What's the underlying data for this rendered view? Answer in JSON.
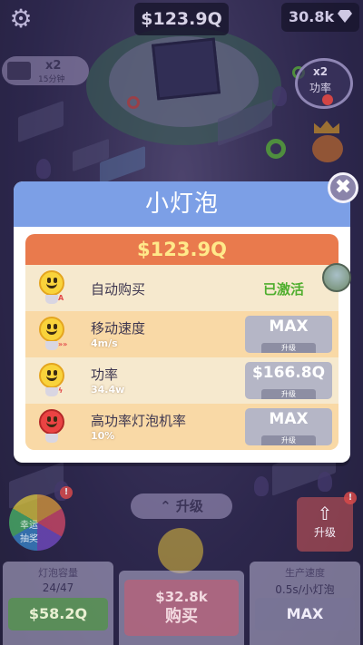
{
  "hud": {
    "money": "$123.9Q",
    "gems": "30.8k",
    "video_boost": {
      "multiplier": "x2",
      "duration": "15分钟"
    },
    "power_boost": {
      "multiplier": "x2",
      "label": "功率"
    }
  },
  "modal": {
    "title": "小灯泡",
    "price": "$123.9Q",
    "rows": [
      {
        "name": "自动购买",
        "sub": "",
        "status": "已激活",
        "button_value": "",
        "button_label": "",
        "icon": "bulb-auto-icon"
      },
      {
        "name": "移动速度",
        "sub": "4m/s",
        "status": "",
        "button_value": "MAX",
        "button_label": "升级",
        "icon": "bulb-speed-icon"
      },
      {
        "name": "功率",
        "sub": "34.4w",
        "status": "",
        "button_value": "$166.8Q",
        "button_label": "升级",
        "icon": "bulb-power-icon"
      },
      {
        "name": "高功率灯泡机率",
        "sub": "10%",
        "status": "",
        "button_value": "MAX",
        "button_label": "升级",
        "icon": "bulb-red-icon"
      }
    ]
  },
  "bottom": {
    "wheel_label": "幸运\n抽奖",
    "upgrade_tab": "升级",
    "upgrade_side": "升级",
    "left_panel": {
      "title": "灯泡容量",
      "info": "24/47",
      "button": "$58.2Q"
    },
    "mid_panel": {
      "price": "$32.8k",
      "label": "购买"
    },
    "right_panel": {
      "title": "生产速度",
      "info": "0.5s/小灯泡",
      "button": "MAX"
    }
  },
  "colors": {
    "header_blue": "#7c9fe6",
    "price_orange": "#e97a4d",
    "price_text": "#ffe98a",
    "active_green": "#4fae2e",
    "row_light": "#f6e9ce",
    "row_alt": "#f9d9a6",
    "button_grey": "#b5b6c6"
  }
}
